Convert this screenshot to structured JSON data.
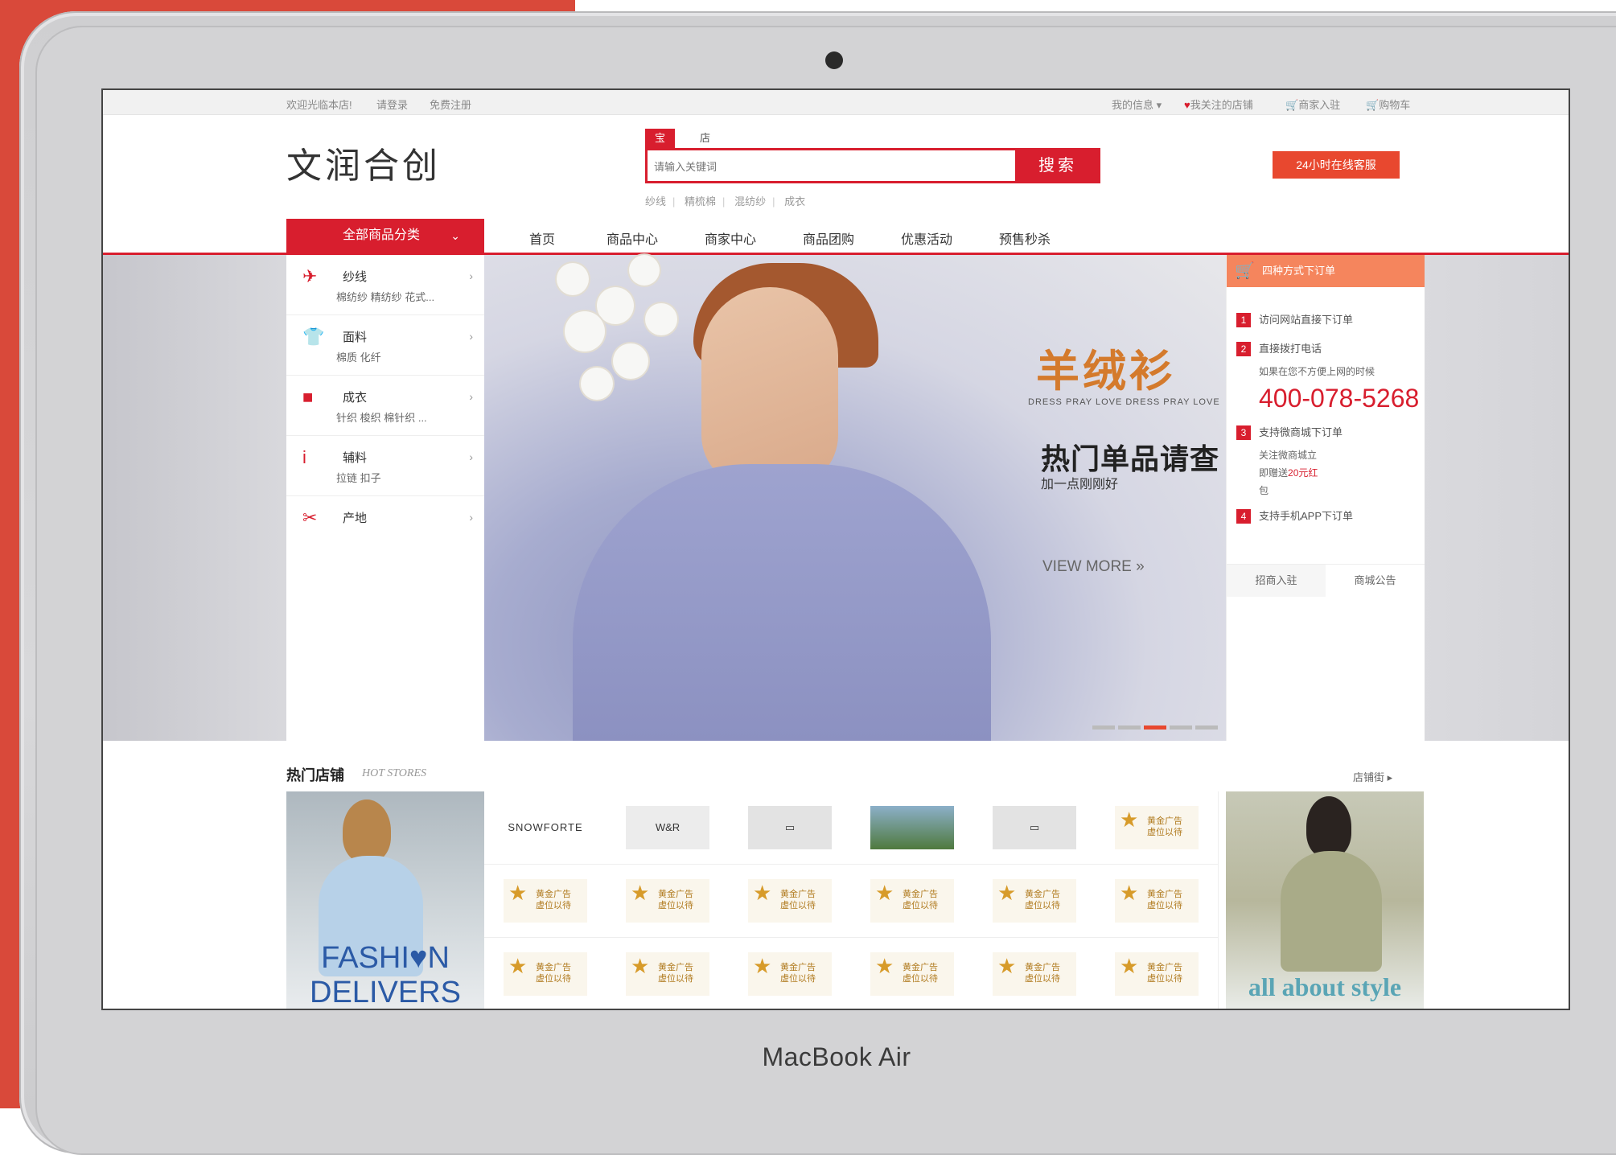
{
  "device": {
    "brand": "MacBook Air"
  },
  "topbar": {
    "welcome": "欢迎光临本店!",
    "login": "请登录",
    "register": "免费注册",
    "my_info": "我的信息",
    "fav_shops": "我关注的店铺",
    "merchant_join": "商家入驻",
    "cart": "购物车"
  },
  "header": {
    "logo": "文润合创",
    "search_tabs": [
      "宝贝",
      "店铺"
    ],
    "search_placeholder": "请输入关键词",
    "search_button": "搜索",
    "hot_keywords": [
      "纱线",
      "精梳棉",
      "混纺纱",
      "成衣"
    ],
    "service_button": "24小时在线客服"
  },
  "nav": {
    "all_categories": "全部商品分类",
    "items": [
      "首页",
      "商品中心",
      "商家中心",
      "商品团购",
      "优惠活动",
      "预售秒杀"
    ]
  },
  "categories": [
    {
      "title": "纱线",
      "sub": "棉纺纱  精纺纱  花式...",
      "icon": "plane-icon"
    },
    {
      "title": "面料",
      "sub": "棉质  化纤",
      "icon": "shirt-icon"
    },
    {
      "title": "成衣",
      "sub": "针织  梭织  棉针织 ...",
      "icon": "bag-icon"
    },
    {
      "title": "辅料",
      "sub": "拉链  扣子",
      "icon": "info-icon"
    },
    {
      "title": "产地",
      "sub": "",
      "icon": "scissors-icon"
    }
  ],
  "hero": {
    "title": "羊绒衫",
    "tagline": "DRESS PRAY LOVE  DRESS PRAY LOVE",
    "headline": "热门单品请查",
    "sub": "加一点刚刚好",
    "more": "VIEW MORE  »",
    "slide_count": 5,
    "active_slide": 3
  },
  "order_panel": {
    "title": "四种方式下订单",
    "steps": [
      "访问网站直接下订单",
      "直接拨打电话",
      "支持微商城下订单",
      "支持手机APP下订单"
    ],
    "note_phone": "如果在您不方便上网的时候",
    "phone": "400-078-5268",
    "note_wechat_1": "关注微商城立",
    "note_wechat_2_pre": "即赠送",
    "note_wechat_2_hl": "20元红",
    "note_wechat_3": "包",
    "tabs": [
      "招商入驻",
      "商城公告"
    ]
  },
  "stores": {
    "title": "热门店铺",
    "title_en": "HOT STORES",
    "more": "店铺街 ▸",
    "left_promo": "FASHI♥N DELIVERS",
    "right_promo": "all about style",
    "logos": [
      "SNOWFORTE",
      "W&R"
    ],
    "ad_text_1": "黄金广告",
    "ad_text_2": "虚位以待"
  },
  "colors": {
    "accent": "#d81e2e",
    "orange": "#e8482f",
    "hero_title": "#d47a2c"
  }
}
